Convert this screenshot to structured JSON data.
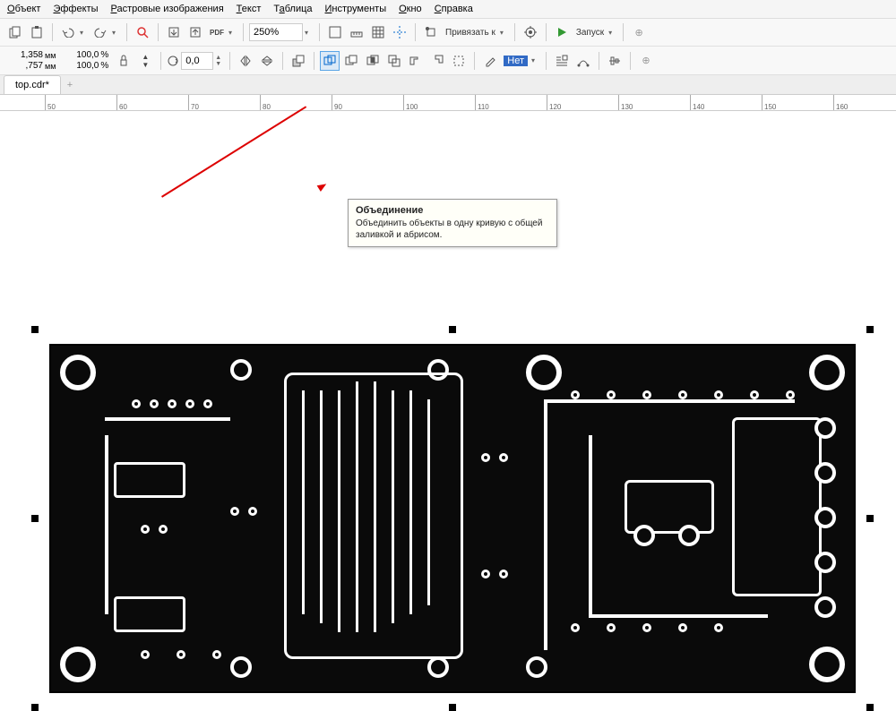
{
  "menu": {
    "object": "Объект",
    "effects": "Эффекты",
    "raster": "Растровые изображения",
    "text": "Текст",
    "table": "Таблица",
    "tools": "Инструменты",
    "window": "Окно",
    "help": "Справка"
  },
  "toolbar1": {
    "zoom": "250%",
    "snap": "Привязать к",
    "launch": "Запуск"
  },
  "propbar": {
    "w_val": "1,358",
    "w_unit": "мм",
    "h_val": ",757",
    "h_unit": "мм",
    "sx": "100,0",
    "sy": "100,0",
    "percent": "%",
    "rotation": "0,0",
    "outline_label": "Нет"
  },
  "tab": {
    "name": "top.cdr*"
  },
  "ruler": {
    "ticks": [
      50,
      60,
      70,
      80,
      90,
      100,
      110,
      120,
      130,
      140,
      150,
      160
    ]
  },
  "tooltip": {
    "title": "Объединение",
    "body": "Объединить объекты в одну кривую с общей заливкой и абрисом."
  }
}
